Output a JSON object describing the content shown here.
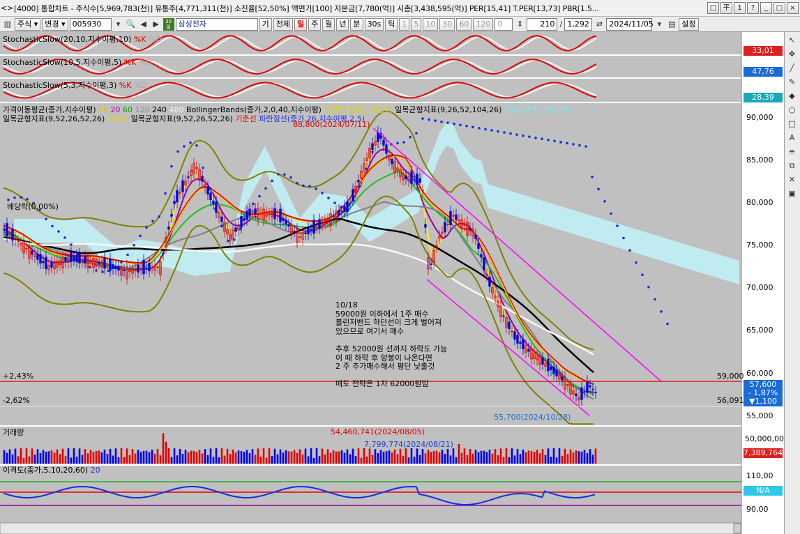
{
  "window": {
    "title": "[4000] 통합차트 - 주식수[5,969,783(천)] 유통주[4,771,311(천)] 소진율[52,50%] 액면가[100] 자본금[7,780(억)] 시총[3,438,595(억)] PER[15,41] T.PER[13,73] PBR[1.5...",
    "buttons": [
      "□",
      "平",
      "1",
      "?",
      "_",
      "□",
      "×"
    ]
  },
  "toolbar": {
    "market": "주식",
    "change": "변경",
    "code": "005930",
    "name": "삼성전자",
    "periods": [
      "기",
      "전체",
      "일",
      "주",
      "월",
      "년",
      "분",
      "30s",
      "틱"
    ],
    "selected_period": "일",
    "minutes": [
      "1",
      "5",
      "10",
      "30",
      "60",
      "120"
    ],
    "minute_value": "0",
    "count": "210",
    "total": "1,292",
    "date": "2024/11/05",
    "settings": "설정"
  },
  "panes": {
    "stoch1": {
      "name": "StochasticSlow(20,10,지수이평,10)",
      "k": "%K",
      "d": "%D",
      "value": "33,01"
    },
    "stoch2": {
      "name": "StochasticSlow(10,5,지수이평,5)",
      "k": "%K",
      "d": "%D",
      "value": "47,76"
    },
    "stoch3": {
      "name": "StochasticSlow(5,3,지수이평,3)",
      "k": "%K",
      "d": "%D",
      "value": "28,39"
    },
    "price": {
      "line1_name": "가격이동평균(종가,지수이평)",
      "ma_periods": [
        "10",
        "20",
        "60",
        "120",
        "240",
        "480"
      ],
      "ma_colors": [
        "#d8c800",
        "#b000b0",
        "#00a000",
        "#909090",
        "#000000",
        "#f0f0f0"
      ],
      "bb_name": "BollingerBands(종가,2,0,40,지수이평)",
      "bb_labels": [
        "상한선",
        "중심선",
        "하한선"
      ],
      "ichi1_name": "일목균형지표(9,26,52,104,26)",
      "ichi1_labels": [
        "선행스팬1",
        "선행스팬2"
      ],
      "line2_a": "일목균형지표(9,52,26,52,26)",
      "line2_a_label": "기준선",
      "line2_b": "일목균형지표(9,52,26,52,26)",
      "line2_b_label": "기준선",
      "line2_c": "파란점선(종가,26,지수이평,2,5)",
      "high_note": "88,800(2024/07/11)",
      "low_note": "55,700(2024/10/28)",
      "dividend_note": "배당락(0,00%)",
      "upper_pct": "+2,43%",
      "lower_pct": "-2,62%",
      "upper_line_value": "59,000",
      "lower_line_value": "56,091",
      "price_ticks": [
        "90,000",
        "85,000",
        "80,000",
        "75,000",
        "70,000",
        "65,000",
        "60,000",
        "55,000"
      ],
      "current_price": "57,600",
      "current_change_pct": "- 1,87%",
      "current_change": "▼1,100",
      "memo": "10/18\n59000원 이하에서 1주 매수\n볼린저밴드 하단선이 크게 벌어져\n있으므로 여기서 매수\n\n추후 52000원 선까지 하락도 가능\n이 때 하락 후 양봉이 나온다면\n2 주 추가매수해서 평단 낮출것\n\n매도 전략은 1차 62000원임"
    },
    "volume": {
      "name": "거래량",
      "max_note": "54,460,741(2024/08/05)",
      "min_note": "7,799,774(2024/08/21)",
      "tick": "50,000,000",
      "current": "7,389,764"
    },
    "disparity": {
      "name": "이격도(종가,5,10,20,60)",
      "extra": "20",
      "ticks": [
        "110,00",
        "90,00"
      ],
      "current": "N/A"
    }
  },
  "colors": {
    "up": "#e00000",
    "down": "#0000e0",
    "panel_bg": "#c0c0c0",
    "cloud": "#bff2f8",
    "channel": "#ff00ff",
    "badge_red": "#e02020",
    "badge_blue": "#1a6ad8",
    "badge_teal": "#18a8b8",
    "badge_cyan": "#30c8e8"
  }
}
